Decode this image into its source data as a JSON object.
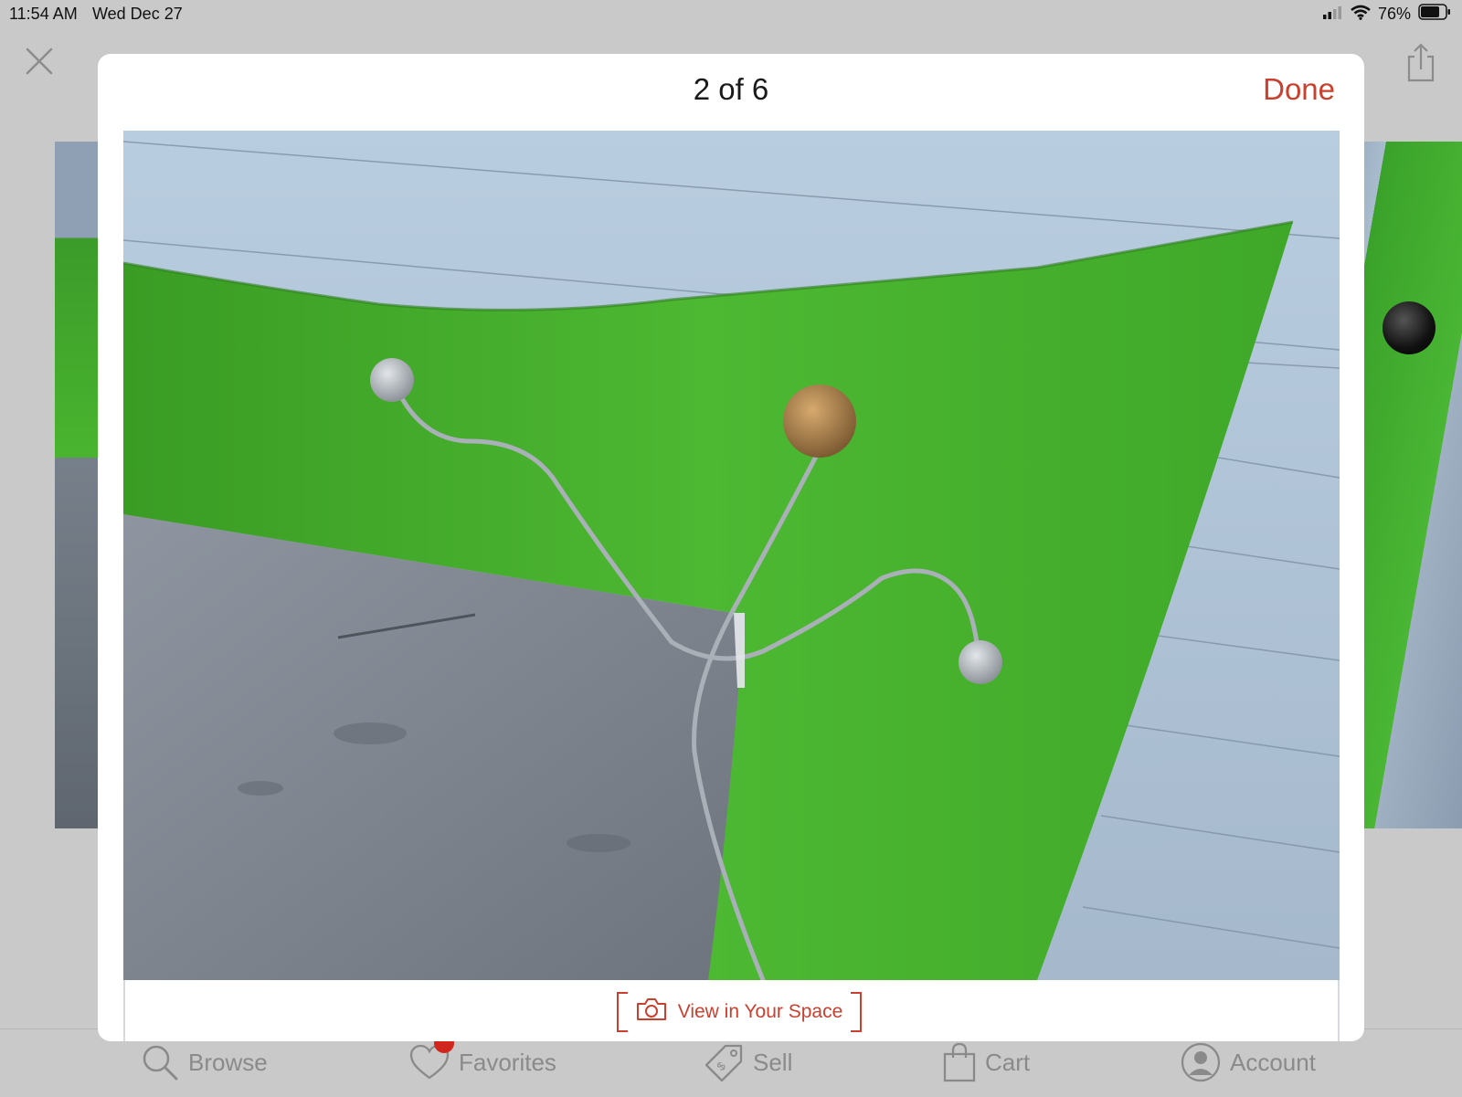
{
  "status_bar": {
    "time": "11:54 AM",
    "date": "Wed Dec 27",
    "battery": "76%",
    "icons": [
      "signal-icon",
      "wifi-icon",
      "battery-icon"
    ]
  },
  "background": {
    "icons": [
      "close-icon",
      "share-icon"
    ]
  },
  "gallery": {
    "counter": "2 of 6",
    "done_label": "Done",
    "view_in_space_label": "View in Your Space",
    "view_in_space_icon": "camera-icon"
  },
  "tab_bar": {
    "items": [
      {
        "label": "Browse",
        "icon": "search-icon"
      },
      {
        "label": "Favorites",
        "icon": "heart-icon",
        "badge": true
      },
      {
        "label": "Sell",
        "icon": "price-tag-icon"
      },
      {
        "label": "Cart",
        "icon": "shopping-bag-icon"
      },
      {
        "label": "Account",
        "icon": "user-icon"
      }
    ]
  },
  "colors": {
    "accent": "#c9402f",
    "badge": "#d0261d",
    "tab_inactive": "#8a8a8a",
    "backdrop": "#c9c9c9"
  }
}
